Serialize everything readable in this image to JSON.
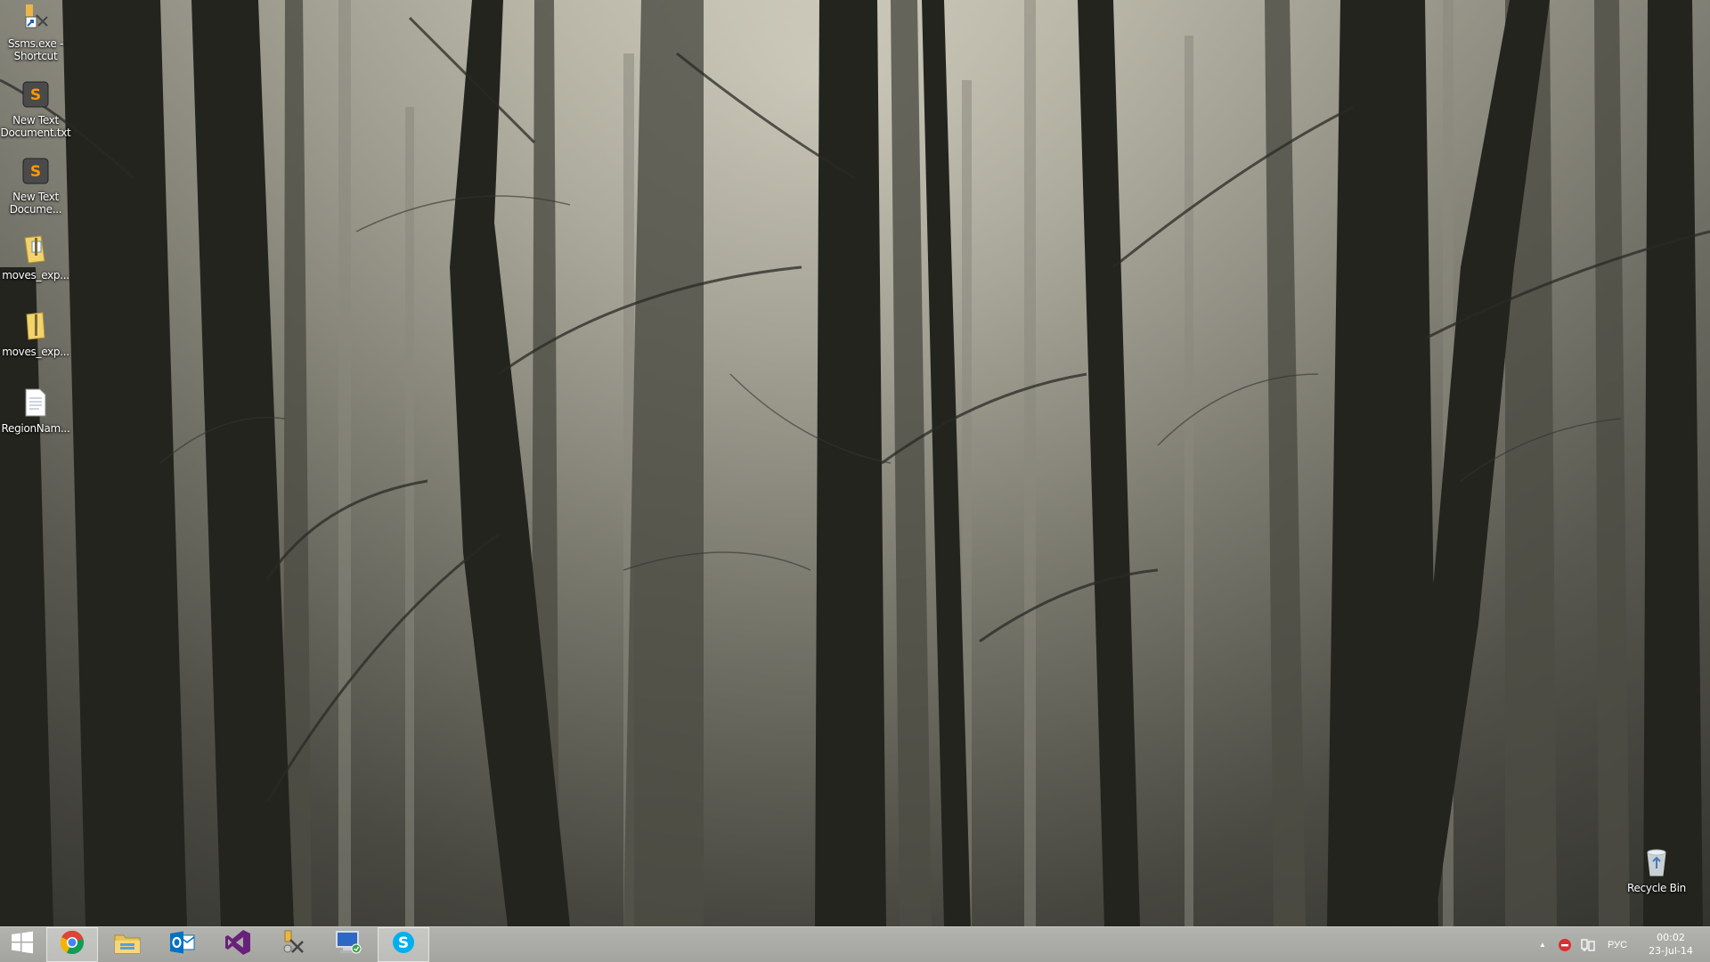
{
  "desktop": {
    "icons": [
      {
        "label": "Ssms.exe - Shortcut",
        "icon": "ssms-shortcut-icon"
      },
      {
        "label": "New Text Document.txt",
        "icon": "sublime-text-icon"
      },
      {
        "label": "New Text Docume...",
        "icon": "sublime-text-icon"
      },
      {
        "label": "moves_exp...",
        "icon": "zip-folder-icon"
      },
      {
        "label": "moves_exp...",
        "icon": "zip-folder-icon"
      },
      {
        "label": "RegionNam...",
        "icon": "text-file-icon"
      }
    ],
    "recycle_bin": {
      "label": "Recycle Bin",
      "icon": "recycle-bin-icon"
    }
  },
  "taskbar": {
    "start": {
      "icon": "windows-logo-icon"
    },
    "pinned": [
      {
        "name": "Google Chrome",
        "icon": "chrome-icon",
        "active": true
      },
      {
        "name": "File Explorer",
        "icon": "file-explorer-icon",
        "active": false
      },
      {
        "name": "Outlook",
        "icon": "outlook-icon",
        "active": false
      },
      {
        "name": "Visual Studio",
        "icon": "visual-studio-icon",
        "active": false
      },
      {
        "name": "SQL Server Management Studio",
        "icon": "ssms-icon",
        "active": false
      },
      {
        "name": "Remote Desktop",
        "icon": "remote-desktop-icon",
        "active": false
      },
      {
        "name": "Skype",
        "icon": "skype-icon",
        "active": true
      }
    ],
    "tray": {
      "show_hidden": "▲",
      "language": "РУС",
      "time": "00:02",
      "date": "23-Jul-14"
    }
  },
  "colors": {
    "taskbar": "#a9aaa5",
    "chrome_red": "#db4437",
    "outlook_blue": "#0072c6",
    "vs_purple": "#68217a",
    "skype_blue": "#00aff0"
  }
}
